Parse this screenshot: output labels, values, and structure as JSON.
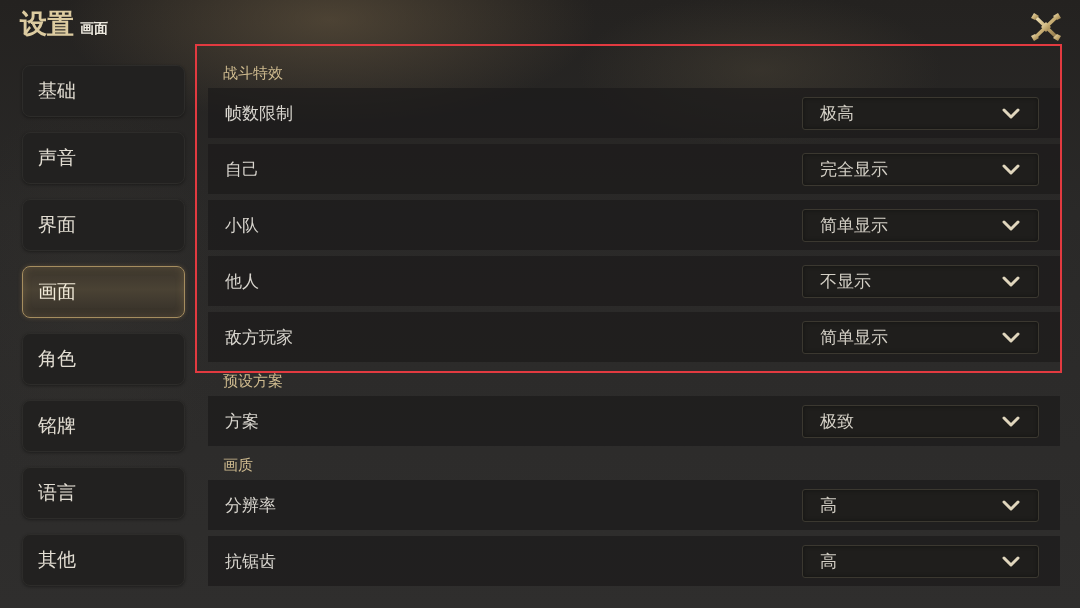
{
  "header": {
    "title": "设置",
    "subtitle": "画面"
  },
  "sidebar": {
    "items": [
      {
        "label": "基础",
        "selected": false
      },
      {
        "label": "声音",
        "selected": false
      },
      {
        "label": "界面",
        "selected": false
      },
      {
        "label": "画面",
        "selected": true
      },
      {
        "label": "角色",
        "selected": false
      },
      {
        "label": "铭牌",
        "selected": false
      },
      {
        "label": "语言",
        "selected": false
      },
      {
        "label": "其他",
        "selected": false
      }
    ]
  },
  "sections": [
    {
      "title": "战斗特效",
      "highlighted": true,
      "rows": [
        {
          "label": "帧数限制",
          "value": "极高"
        },
        {
          "label": "自己",
          "value": "完全显示"
        },
        {
          "label": "小队",
          "value": "简单显示"
        },
        {
          "label": "他人",
          "value": "不显示"
        },
        {
          "label": "敌方玩家",
          "value": "简单显示"
        }
      ]
    },
    {
      "title": "预设方案",
      "highlighted": false,
      "rows": [
        {
          "label": "方案",
          "value": "极致"
        }
      ]
    },
    {
      "title": "画质",
      "highlighted": false,
      "rows": [
        {
          "label": "分辨率",
          "value": "高"
        },
        {
          "label": "抗锯齿",
          "value": "高"
        }
      ]
    }
  ]
}
